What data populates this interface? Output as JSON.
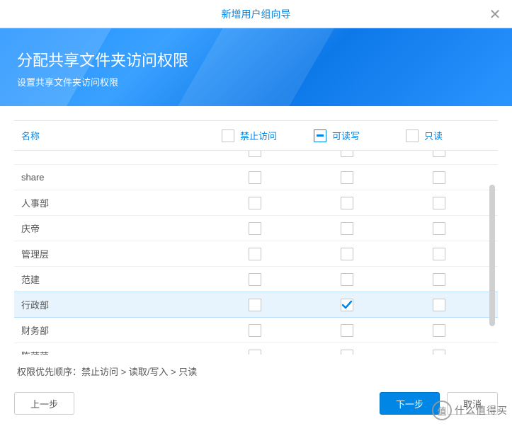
{
  "title": "新增用户组向导",
  "banner": {
    "title": "分配共享文件夹访问权限",
    "subtitle": "设置共享文件夹访问权限"
  },
  "columns": {
    "name": "名称",
    "no_access": "禁止访问",
    "read_write": "可读写",
    "read_only": "只读"
  },
  "header_state": {
    "read_write_partial": true
  },
  "rows": [
    {
      "name": "",
      "partial_top": true,
      "no_access": false,
      "read_write": false,
      "read_only": false
    },
    {
      "name": "share",
      "no_access": false,
      "read_write": false,
      "read_only": false
    },
    {
      "name": "人事部",
      "no_access": false,
      "read_write": false,
      "read_only": false
    },
    {
      "name": "庆帝",
      "no_access": false,
      "read_write": false,
      "read_only": false
    },
    {
      "name": "管理层",
      "no_access": false,
      "read_write": false,
      "read_only": false
    },
    {
      "name": "范建",
      "no_access": false,
      "read_write": false,
      "read_only": false
    },
    {
      "name": "行政部",
      "selected": true,
      "no_access": false,
      "read_write": true,
      "read_only": false
    },
    {
      "name": "财务部",
      "no_access": false,
      "read_write": false,
      "read_only": false
    },
    {
      "name": "陈萍萍",
      "no_access": false,
      "read_write": false,
      "read_only": false
    }
  ],
  "priority_text": "权限优先顺序：禁止访问 > 读取/写入 > 只读",
  "buttons": {
    "prev": "上一步",
    "next": "下一步",
    "cancel": "取消"
  },
  "watermark": {
    "badge": "值",
    "text": "什么值得买"
  }
}
